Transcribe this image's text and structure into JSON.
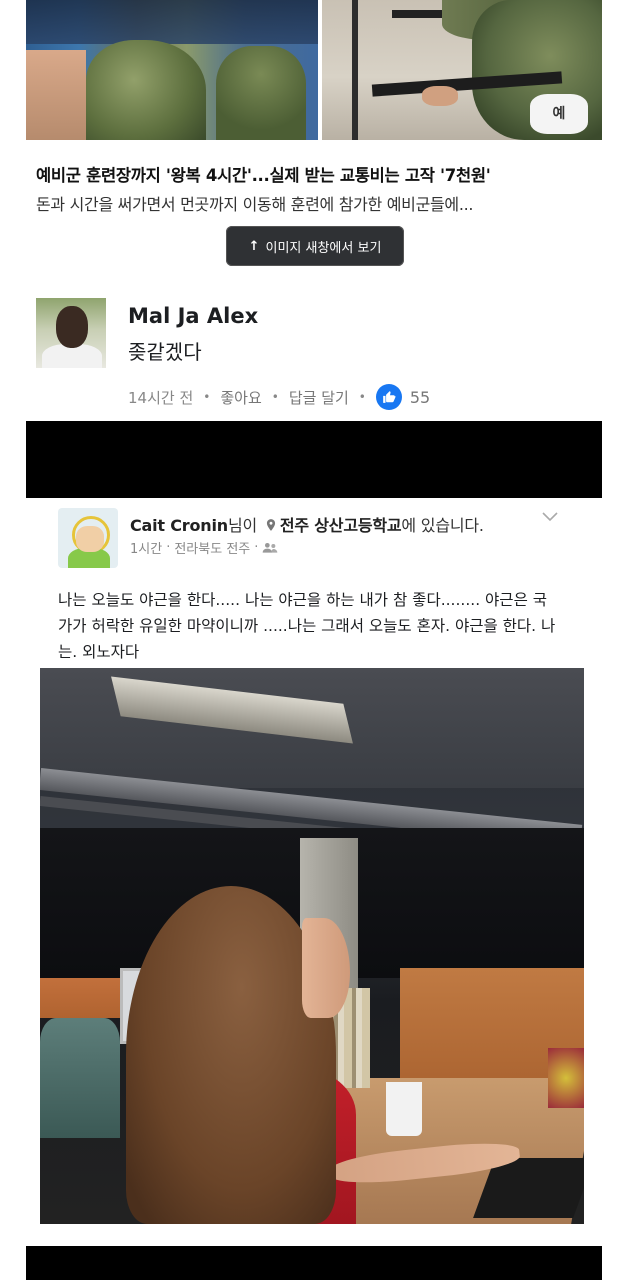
{
  "news_card": {
    "title": "예비군 훈련장까지 '왕복 4시간'...실제 받는 교통비는 고작 '7천원'",
    "description": "돈과 시간을 써가면서 먼곳까지 이동해 훈련에 참가한 예비군들에...",
    "armband_text": "예",
    "view_button": {
      "arrow": "↑",
      "label": "이미지 새창에서 보기"
    }
  },
  "comment": {
    "author": "Mal Ja Alex",
    "text": "좆같겠다",
    "time": "14시간 전",
    "like_label": "좋아요",
    "reply_label": "답글 달기",
    "like_count": "55",
    "separator": "•"
  },
  "post": {
    "author": "Cait Cronin",
    "author_suffix": "님이",
    "place": "전주 상산고등학교",
    "place_suffix": "에 있습니다.",
    "time": "1시간",
    "location": "전라북도 전주",
    "meta_separator": "·",
    "text": "나는 오늘도 야근을 한다..... 나는 야근을 하는 내가 참 좋다........ 야근은 국가가 허락한 유일한 마약이니까 .....나는 그래서 오늘도 혼자. 야근을 한다. 나는. 외노자다"
  },
  "colors": {
    "like_blue": "#1877f2",
    "band_black": "#000000",
    "button_dark": "#2f3134"
  },
  "icons": [
    "pin-icon",
    "friends-icon",
    "chevron-down-icon",
    "thumbs-up-icon",
    "arrow-up-icon"
  ]
}
